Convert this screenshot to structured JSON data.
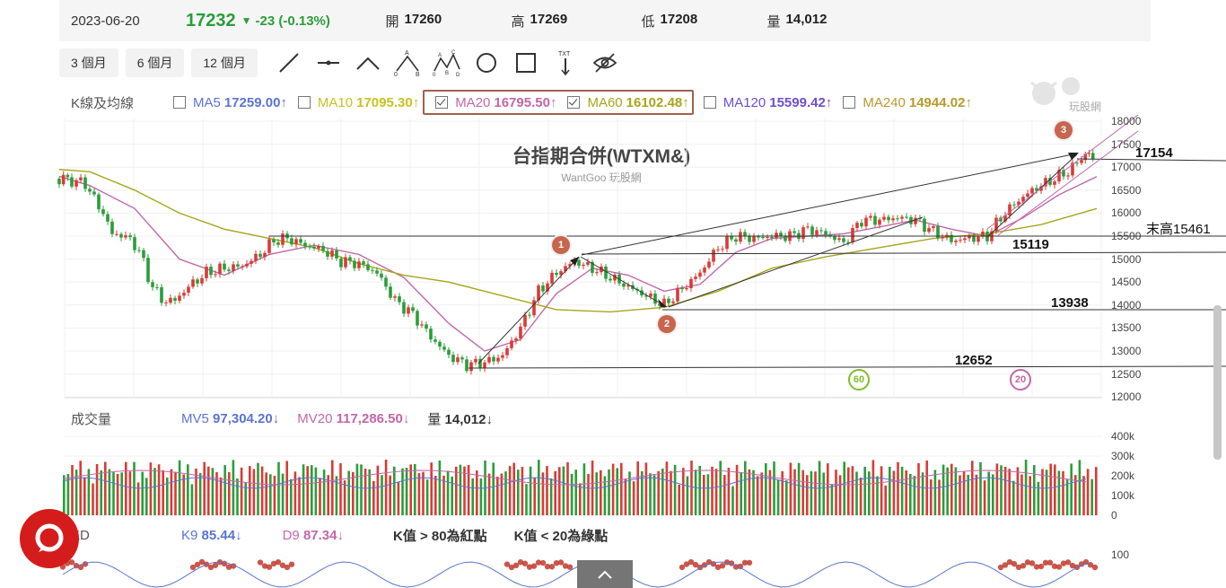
{
  "quote": {
    "date": "2023-06-20",
    "price": "17232",
    "change": "-23 (-0.13%)",
    "open_label": "開",
    "open": "17260",
    "high_label": "高",
    "high": "17269",
    "low_label": "低",
    "low": "17208",
    "volume_label": "量",
    "volume": "14,012"
  },
  "periods": [
    "3 個月",
    "6 個月",
    "12 個月"
  ],
  "tools": [
    "trend-line-icon",
    "horizontal-line-icon",
    "wave-icon",
    "abc-wave-icon",
    "abcd-wave-icon",
    "circle-icon",
    "rectangle-icon",
    "text-icon",
    "hide-icon"
  ],
  "ma": {
    "title": "K線及均線",
    "items": [
      {
        "label": "MA5",
        "value": "17259.00",
        "arrow": "↑",
        "checked": false,
        "color": "#5b74d1"
      },
      {
        "label": "MA10",
        "value": "17095.30",
        "arrow": "↑",
        "checked": false,
        "color": "#c8c21f"
      },
      {
        "label": "MA20",
        "value": "16795.50",
        "arrow": "↑",
        "checked": true,
        "color": "#c267a8"
      },
      {
        "label": "MA60",
        "value": "16102.48",
        "arrow": "↑",
        "checked": true,
        "color": "#a7a51b"
      },
      {
        "label": "MA120",
        "value": "15599.42",
        "arrow": "↑",
        "checked": false,
        "color": "#6c4fd0"
      },
      {
        "label": "MA240",
        "value": "14944.02",
        "arrow": "↑",
        "checked": false,
        "color": "#b89a2a"
      }
    ]
  },
  "chart_title": "台指期合併(WTXM&)",
  "chart_subtitle": "WantGoo 玩股網",
  "watermark": "玩股網",
  "price_axis": [
    "18000",
    "17500",
    "17000",
    "16500",
    "16000",
    "15500",
    "15000",
    "14500",
    "14000",
    "13500",
    "13000",
    "12500",
    "12000"
  ],
  "levels": [
    {
      "label": "17154"
    },
    {
      "label": "末高15461"
    },
    {
      "label": "15119"
    },
    {
      "label": "13938"
    },
    {
      "label": "12652"
    }
  ],
  "markers": [
    "1",
    "2",
    "3"
  ],
  "ma_tags": [
    "60",
    "20"
  ],
  "volume": {
    "title": "成交量",
    "mv5_label": "MV5",
    "mv5": "97,304.20",
    "mv5_arrow": "↓",
    "mv20_label": "MV20",
    "mv20": "117,286.50",
    "mv20_arrow": "↓",
    "vol_label": "量",
    "vol": "14,012",
    "vol_arrow": "↓",
    "axis": [
      "400k",
      "300k",
      "200k",
      "100k",
      "0"
    ]
  },
  "kd": {
    "title": "KD",
    "k_label": "K9",
    "k": "85.44",
    "k_arrow": "↓",
    "d_label": "D9",
    "d": "87.34",
    "d_arrow": "↓",
    "note1": "K值 > 80為紅點",
    "note2": "K值 < 20為綠點",
    "axis": [
      "100"
    ]
  },
  "colors": {
    "up": "#d93b36",
    "down": "#2a9d3a",
    "ma20": "#c267a8",
    "ma60": "#a7a51b",
    "marker": "#c8654e"
  }
}
